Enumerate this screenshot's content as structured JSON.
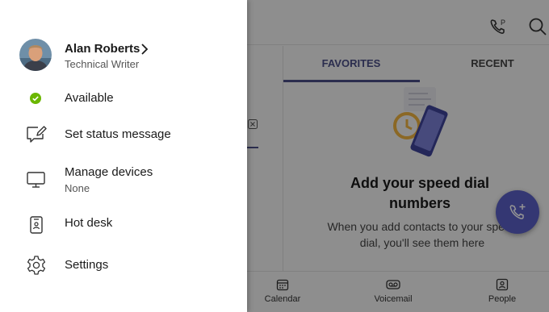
{
  "profile": {
    "name": "Alan Roberts",
    "title": "Technical Writer"
  },
  "menu": {
    "availability": "Available",
    "set_status": "Set status message",
    "manage_devices": "Manage devices",
    "manage_devices_sub": "None",
    "hot_desk": "Hot desk",
    "settings": "Settings"
  },
  "background": {
    "tabs": [
      "FAVORITES",
      "RECENT"
    ],
    "empty_title": "Add your speed dial numbers",
    "empty_text": "When you add contacts to your speed dial, you'll see them here",
    "nav": [
      "Calendar",
      "Voicemail",
      "People"
    ]
  },
  "colors": {
    "accent": "#4a4f87",
    "fab": "#5b5fc7",
    "available": "#6bb700"
  },
  "icons": [
    "status-dot-icon",
    "status-message-icon",
    "monitor-icon",
    "hot-desk-icon",
    "gear-icon",
    "chevron-right-icon",
    "call-park-icon",
    "search-icon",
    "add-call-icon",
    "calendar-icon",
    "voicemail-icon",
    "people-icon"
  ]
}
